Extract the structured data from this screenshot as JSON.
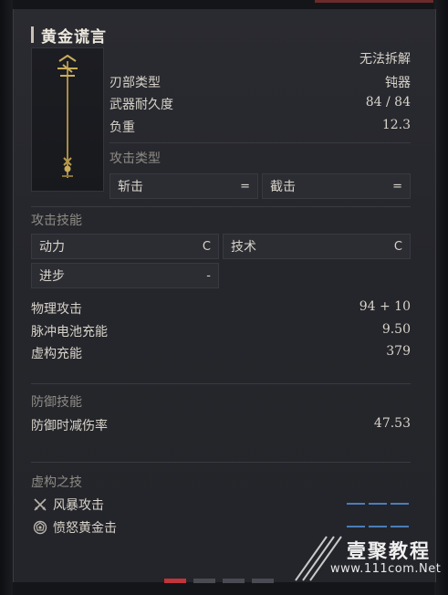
{
  "item": {
    "name": "黄金谎言",
    "status": "无法拆解",
    "blade_type_label": "刃部类型",
    "blade_type_value": "钝器",
    "durability_label": "武器耐久度",
    "durability_value": "84 / 84",
    "weight_label": "负重",
    "weight_value": "12.3"
  },
  "attack_type": {
    "title": "攻击类型",
    "cells": [
      {
        "label": "斩击",
        "value": "="
      },
      {
        "label": "截击",
        "value": "="
      }
    ]
  },
  "attack_skill": {
    "title": "攻击技能",
    "cells": [
      {
        "label": "动力",
        "value": "C"
      },
      {
        "label": "技术",
        "value": "C"
      },
      {
        "label": "进步",
        "value": "-"
      }
    ]
  },
  "stats": [
    {
      "label": "物理攻击",
      "value": "94 + 10"
    },
    {
      "label": "脉冲电池充能",
      "value": "9.50"
    },
    {
      "label": "虚构充能",
      "value": "379"
    }
  ],
  "defense": {
    "title": "防御技能",
    "label": "防御时减伤率",
    "value": "47.53"
  },
  "fable_arts": {
    "title": "虚构之技",
    "skills": [
      {
        "label": "风暴攻击",
        "icon": "crossed-swords-icon",
        "slots": 3
      },
      {
        "label": "愤怒黄金击",
        "icon": "shield-gear-icon",
        "slots": 3
      }
    ]
  },
  "pager": {
    "pages": 4,
    "active": 0
  },
  "watermark": {
    "brand": "壹聚教程",
    "url": "www.111com.Net"
  },
  "colors": {
    "accent_red": "#c0343a",
    "slot_blue": "#4b7db8",
    "gold": "#b89a4a"
  }
}
